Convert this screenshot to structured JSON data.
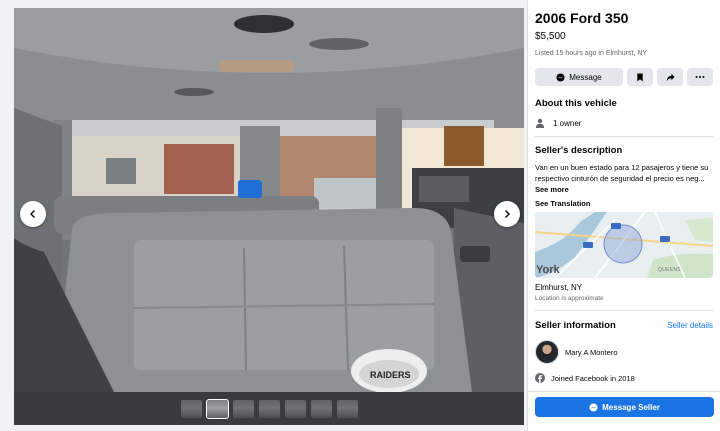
{
  "listing": {
    "title": "2006 Ford 350",
    "price": "$5,500",
    "posted_meta": "Listed 15 hours ago in Elmhurst, NY",
    "message_label": "Message"
  },
  "about": {
    "heading": "About this vehicle",
    "owners": "1 owner"
  },
  "description": {
    "heading": "Seller's description",
    "text": "Van en un buen estado para 12 pasajeros y tiene su respectivo cinturón de seguridad el precio es neg...",
    "see_more": "See more",
    "see_translation": "See Translation"
  },
  "map": {
    "city_label": "York",
    "district_label": "QUEENS"
  },
  "location": {
    "name": "Elmhurst, NY",
    "note": "Location is approximate"
  },
  "seller": {
    "heading": "Seller information",
    "details_link": "Seller details",
    "name": "Mary A Montero",
    "joined": "Joined Facebook in 2018"
  },
  "cta": {
    "label": "Message Seller"
  },
  "photo": {
    "hat_text": "RAIDERS",
    "thumbnail_count": 7,
    "active_thumbnail": 2
  },
  "colors": {
    "accent": "#1b74e4",
    "link": "#1877f2",
    "button_grey": "#e4e6eb"
  },
  "icons": [
    "chevron-left-icon",
    "chevron-right-icon",
    "messenger-icon",
    "bookmark-icon",
    "share-icon",
    "more-icon",
    "person-icon",
    "facebook-icon"
  ]
}
